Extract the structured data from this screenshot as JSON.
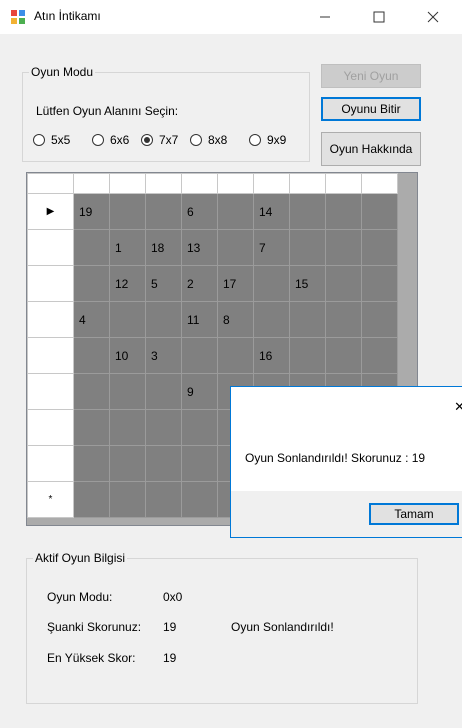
{
  "window": {
    "title": "Atın İntikamı",
    "minimize_glyph": "—",
    "maximize_glyph": "☐",
    "close_glyph": "✕"
  },
  "mode_group": {
    "legend": "Oyun Modu",
    "prompt": "Lütfen Oyun Alanını Seçin:",
    "options": [
      {
        "label": "5x5",
        "checked": false
      },
      {
        "label": "6x6",
        "checked": false
      },
      {
        "label": "7x7",
        "checked": true
      },
      {
        "label": "8x8",
        "checked": false
      },
      {
        "label": "9x9",
        "checked": false
      }
    ]
  },
  "buttons": {
    "new_game": "Yeni Oyun",
    "end_game": "Oyunu Bitir",
    "about": "Oyun Hakkında"
  },
  "grid": {
    "rows": [
      [
        "19",
        "",
        "",
        "6",
        "",
        "14",
        "",
        "",
        ""
      ],
      [
        "",
        "1",
        "18",
        "13",
        "",
        "7",
        "",
        "",
        ""
      ],
      [
        "",
        "12",
        "5",
        "2",
        "17",
        "",
        "15",
        "",
        ""
      ],
      [
        "4",
        "",
        "",
        "11",
        "8",
        "",
        "",
        "",
        ""
      ],
      [
        "",
        "10",
        "3",
        "",
        "",
        "16",
        "",
        "",
        ""
      ],
      [
        "",
        "",
        "",
        "9",
        "",
        "",
        "",
        "",
        ""
      ],
      [
        "",
        "",
        "",
        "",
        "",
        "",
        "",
        "",
        ""
      ],
      [
        "",
        "",
        "",
        "",
        "",
        "",
        "",
        "",
        ""
      ],
      [
        "",
        "",
        "",
        "",
        "",
        "",
        "",
        "",
        ""
      ]
    ],
    "current_row_marker": "▶",
    "new_row_marker": "*"
  },
  "dialog": {
    "message": "Oyun Sonlandırıldı! Skorunuz : 19",
    "ok_label": "Tamam",
    "close_glyph": "✕"
  },
  "info_group": {
    "legend": "Aktif Oyun Bilgisi",
    "mode_label": "Oyun Modu:",
    "mode_value": "0x0",
    "score_label": "Şuanki Skorunuz:",
    "score_value": "19",
    "status": "Oyun Sonlandırıldı!",
    "best_label": "En Yüksek Skor:",
    "best_value": "19"
  }
}
